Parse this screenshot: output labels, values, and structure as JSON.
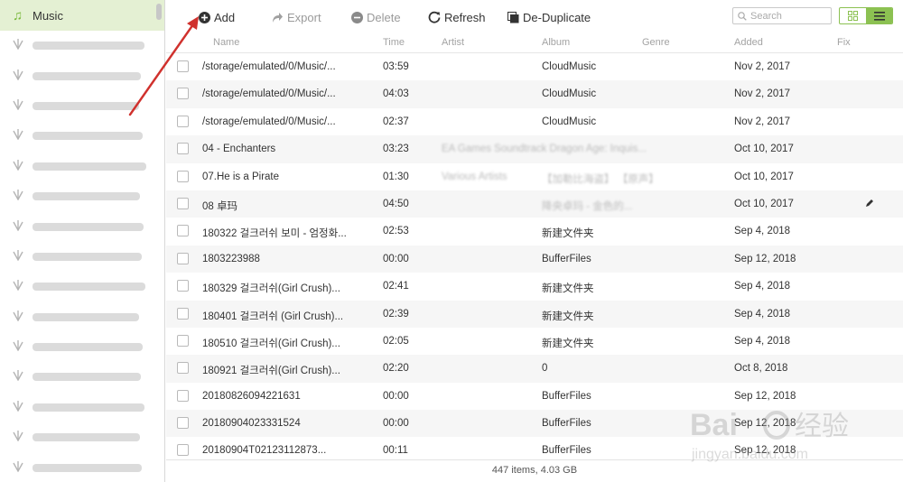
{
  "sidebar": {
    "active_label": "Music",
    "playlist_count": 15
  },
  "toolbar": {
    "add_label": "Add",
    "export_label": "Export",
    "delete_label": "Delete",
    "refresh_label": "Refresh",
    "dedupe_label": "De-Duplicate",
    "search_placeholder": "Search"
  },
  "table": {
    "headers": [
      "Name",
      "Time",
      "Artist",
      "Album",
      "Genre",
      "Added",
      "Fix"
    ],
    "rows": [
      {
        "name": "/storage/emulated/0/Music/...",
        "time": "03:59",
        "artist": "",
        "album": "CloudMusic",
        "added": "Nov 2, 2017"
      },
      {
        "name": "/storage/emulated/0/Music/...",
        "time": "04:03",
        "artist": "",
        "album": "CloudMusic",
        "added": "Nov 2, 2017"
      },
      {
        "name": "/storage/emulated/0/Music/...",
        "time": "02:37",
        "artist": "",
        "album": "CloudMusic",
        "added": "Nov 2, 2017"
      },
      {
        "name": "04 - Enchanters",
        "time": "03:23",
        "artist": "EA Games Soundtrack Dragon Age: Inquis...",
        "album": "",
        "added": "Oct 10, 2017"
      },
      {
        "name": "07.He is a Pirate",
        "time": "01:30",
        "artist": "Various Artists",
        "album": "【加勒比海盗】 【原声】",
        "added": "Oct 10, 2017"
      },
      {
        "name": "08 卓玛",
        "time": "04:50",
        "artist": "",
        "album": "降央卓玛 - 金色的...",
        "added": "Oct 10, 2017",
        "fix": true
      },
      {
        "name": "180322 걸크러쉬 보미 - 엄정화...",
        "time": "02:53",
        "artist": "",
        "album": "新建文件夹",
        "added": "Sep 4, 2018"
      },
      {
        "name": "1803223988",
        "time": "00:00",
        "artist": "",
        "album": "BufferFiles",
        "added": "Sep 12, 2018"
      },
      {
        "name": "180329 걸크러쉬(Girl Crush)...",
        "time": "02:41",
        "artist": "",
        "album": "新建文件夹",
        "added": "Sep 4, 2018"
      },
      {
        "name": "180401 걸크러쉬 (Girl Crush)...",
        "time": "02:39",
        "artist": "",
        "album": "新建文件夹",
        "added": "Sep 4, 2018"
      },
      {
        "name": "180510 걸크러쉬(Girl Crush)...",
        "time": "02:05",
        "artist": "",
        "album": "新建文件夹",
        "added": "Sep 4, 2018"
      },
      {
        "name": "180921 걸크러쉬(Girl Crush)...",
        "time": "02:20",
        "artist": "",
        "album": "0",
        "added": "Oct 8, 2018"
      },
      {
        "name": "20180826094221631",
        "time": "00:00",
        "artist": "",
        "album": "BufferFiles",
        "added": "Sep 12, 2018"
      },
      {
        "name": "20180904023331524",
        "time": "00:00",
        "artist": "",
        "album": "BufferFiles",
        "added": "Sep 12, 2018"
      },
      {
        "name": "20180904T02123112873...",
        "time": "00:11",
        "artist": "",
        "album": "BufferFiles",
        "added": "Sep 12, 2018"
      }
    ]
  },
  "footer": {
    "summary": "447 items, 4.03 GB"
  },
  "watermark": "Baidu经验 jingyan.baidu.com",
  "colors": {
    "accent": "#8cc152",
    "active_bg": "#e4f0d3",
    "annotation_arrow": "#d0312d"
  }
}
